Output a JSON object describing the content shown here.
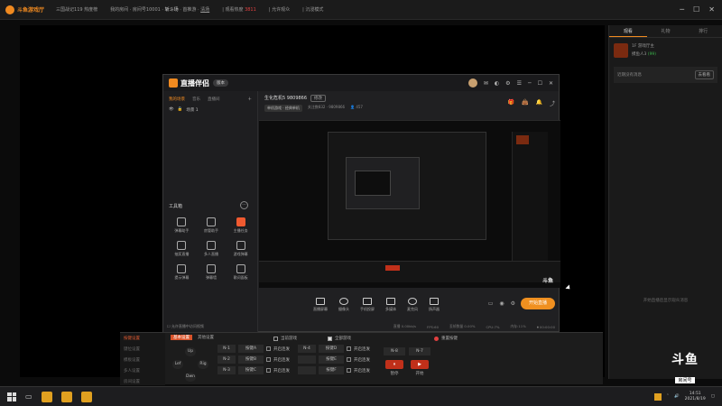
{
  "topbar": {
    "app_name": "斗鱼游戏厅",
    "seg1": "三国战记119 热度榜",
    "seg2_label": "我的房间 · 房间号10001 ·",
    "seg2_bold": "斩斗场",
    "seg3": "· 首推游 ·",
    "seg3_link": "清场",
    "seg4": "| 观看热度",
    "seg4_red": "3811",
    "seg5": "| 允许观众",
    "seg6": "| 沉浸模式"
  },
  "right_panel": {
    "tabs": [
      "观看",
      "礼物",
      "排行"
    ],
    "user_name": "1F 游戏厅主",
    "user_sub": "摸鱼人3",
    "user_status": "(99)",
    "notice_text": "近期没有消息",
    "notice_btn": "去看看",
    "footer_hint": "开始直播后显示观众消息"
  },
  "app": {
    "brand": "直播伴侣",
    "version": "版本",
    "left_tabs": [
      "我的场景",
      "音乐",
      "直播间"
    ],
    "scene_name": "场景 1",
    "tools_title": "工具箱",
    "tools_more": "···",
    "tools": [
      {
        "label": "弹幕助手",
        "hot": false
      },
      {
        "label": "房管助手",
        "hot": false
      },
      {
        "label": "主播任务",
        "hot": true
      },
      {
        "label": "抽奖直播",
        "hot": false
      },
      {
        "label": "多人直播",
        "hot": false
      },
      {
        "label": "游戏弹幕",
        "hot": false
      },
      {
        "label": "提示弹幕",
        "hot": false
      },
      {
        "label": "弹幕墙",
        "hot": false
      },
      {
        "label": "歌词面板",
        "hot": false
      }
    ],
    "tip": "☐ 允许直播中访问视频",
    "room_title": "生化危机5 9809866",
    "room_edit": "修改",
    "room_category": "单机游戏 · 经典单机",
    "room_followers": "关注数832 · 9809866",
    "room_online": "👤 457",
    "controls": [
      "直播屏幕",
      "摄像头",
      "手机投屏",
      "多媒体",
      "麦克风",
      "扬声器"
    ],
    "start_btn": "开始直播",
    "status": [
      "直播 0.00kb/s",
      "FPS:60",
      "丢帧数量 0.00%",
      "CPU:7%",
      "内存:11%",
      "⏺ 00:00:00"
    ],
    "watermark": "斗鱼"
  },
  "macro": {
    "side_tabs": [
      "按键设置",
      "键位设置",
      "模板设置",
      "多人设置",
      "房间设置"
    ],
    "active_tag": "基本设置",
    "top_label": "其他设置",
    "h_current": "当前游戏",
    "h_all": "全部游戏",
    "h_reset": "重置按键",
    "dpad": {
      "up": "Up",
      "left": "Lef",
      "right": "Rig",
      "down": "Dwn"
    },
    "rows": [
      {
        "n1": "N-1",
        "key1": "按键A",
        "rep1": "开启连发",
        "n2": "N-4",
        "key2": "按键D",
        "rep2": "开启连发"
      },
      {
        "n1": "N-2",
        "key1": "按键B",
        "rep1": "开启连发",
        "n2": "",
        "key2": "按键E",
        "rep2": "开启连发"
      },
      {
        "n1": "N-3",
        "key1": "按键C",
        "rep1": "开启连发",
        "n2": "",
        "key2": "按键F",
        "rep2": "开启连发"
      }
    ],
    "n8": "N-8",
    "n7": "N-7",
    "btn_pause": "暂停",
    "btn_start": "开始"
  },
  "douyu_logo": {
    "text": "斗鱼",
    "tag": "房间号",
    "number": "9809866"
  },
  "taskbar": {
    "time": "14:51",
    "date": "2021/8/19"
  }
}
